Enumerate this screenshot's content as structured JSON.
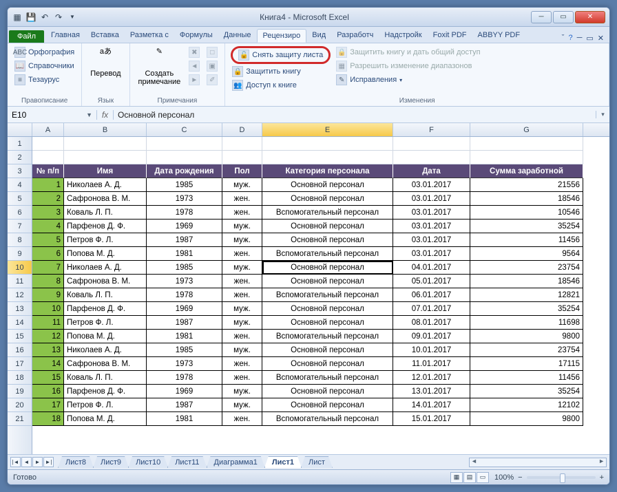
{
  "title": "Книга4  -  Microsoft Excel",
  "tabs": {
    "file": "Файл",
    "list": [
      "Главная",
      "Вставка",
      "Разметка с",
      "Формулы",
      "Данные",
      "Рецензиро",
      "Вид",
      "Разработч",
      "Надстройк",
      "Foxit PDF",
      "ABBYY PDF"
    ],
    "activeIndex": 5
  },
  "ribbon": {
    "g1_label": "Правописание",
    "g1": {
      "spell": "Орфография",
      "ref": "Справочники",
      "thes": "Тезаурус"
    },
    "g2_label": "Язык",
    "g2": "Перевод",
    "g3_label": "Примечания",
    "g3": "Создать\nпримечание",
    "g4_label": "Изменения",
    "g4": {
      "unprotect_sheet": "Снять защиту листа",
      "protect_book": "Защитить книгу",
      "share_book": "Доступ к книге",
      "protect_share": "Защитить книгу и дать общий доступ",
      "allow_ranges": "Разрешить изменение диапазонов",
      "track": "Исправления"
    }
  },
  "namebox": "E10",
  "formula": "Основной персонал",
  "cols": [
    "A",
    "B",
    "C",
    "D",
    "E",
    "F",
    "G"
  ],
  "selColIndex": 4,
  "rows_start": 1,
  "selRowIndex": 10,
  "headers": [
    "№ п/п",
    "Имя",
    "Дата рождения",
    "Пол",
    "Категория персонала",
    "Дата",
    "Сумма заработной"
  ],
  "data": [
    [
      1,
      "Николаев А. Д.",
      "1985",
      "муж.",
      "Основной персонал",
      "03.01.2017",
      "21556"
    ],
    [
      2,
      "Сафронова В. М.",
      "1973",
      "жен.",
      "Основной персонал",
      "03.01.2017",
      "18546"
    ],
    [
      3,
      "Коваль Л. П.",
      "1978",
      "жен.",
      "Вспомогательный персонал",
      "03.01.2017",
      "10546"
    ],
    [
      4,
      "Парфенов Д. Ф.",
      "1969",
      "муж.",
      "Основной персонал",
      "03.01.2017",
      "35254"
    ],
    [
      5,
      "Петров Ф. Л.",
      "1987",
      "муж.",
      "Основной персонал",
      "03.01.2017",
      "11456"
    ],
    [
      6,
      "Попова М. Д.",
      "1981",
      "жен.",
      "Вспомогательный персонал",
      "03.01.2017",
      "9564"
    ],
    [
      7,
      "Николаев А. Д.",
      "1985",
      "муж.",
      "Основной персонал",
      "04.01.2017",
      "23754"
    ],
    [
      8,
      "Сафронова В. М.",
      "1973",
      "жен.",
      "Основной персонал",
      "05.01.2017",
      "18546"
    ],
    [
      9,
      "Коваль Л. П.",
      "1978",
      "жен.",
      "Вспомогательный персонал",
      "06.01.2017",
      "12821"
    ],
    [
      10,
      "Парфенов Д. Ф.",
      "1969",
      "муж.",
      "Основной персонал",
      "07.01.2017",
      "35254"
    ],
    [
      11,
      "Петров Ф. Л.",
      "1987",
      "муж.",
      "Основной персонал",
      "08.01.2017",
      "11698"
    ],
    [
      12,
      "Попова М. Д.",
      "1981",
      "жен.",
      "Вспомогательный персонал",
      "09.01.2017",
      "9800"
    ],
    [
      13,
      "Николаев А. Д.",
      "1985",
      "муж.",
      "Основной персонал",
      "10.01.2017",
      "23754"
    ],
    [
      14,
      "Сафронова В. М.",
      "1973",
      "жен.",
      "Основной персонал",
      "11.01.2017",
      "17115"
    ],
    [
      15,
      "Коваль Л. П.",
      "1978",
      "жен.",
      "Вспомогательный персонал",
      "12.01.2017",
      "11456"
    ],
    [
      16,
      "Парфенов Д. Ф.",
      "1969",
      "муж.",
      "Основной персонал",
      "13.01.2017",
      "35254"
    ],
    [
      17,
      "Петров Ф. Л.",
      "1987",
      "муж.",
      "Основной персонал",
      "14.01.2017",
      "12102"
    ],
    [
      18,
      "Попова М. Д.",
      "1981",
      "жен.",
      "Вспомогательный персонал",
      "15.01.2017",
      "9800"
    ]
  ],
  "sheets": [
    "Лист8",
    "Лист9",
    "Лист10",
    "Лист11",
    "Диаграмма1",
    "Лист1",
    "Лист"
  ],
  "activeSheetIndex": 5,
  "status": "Готово",
  "zoom": "100%"
}
